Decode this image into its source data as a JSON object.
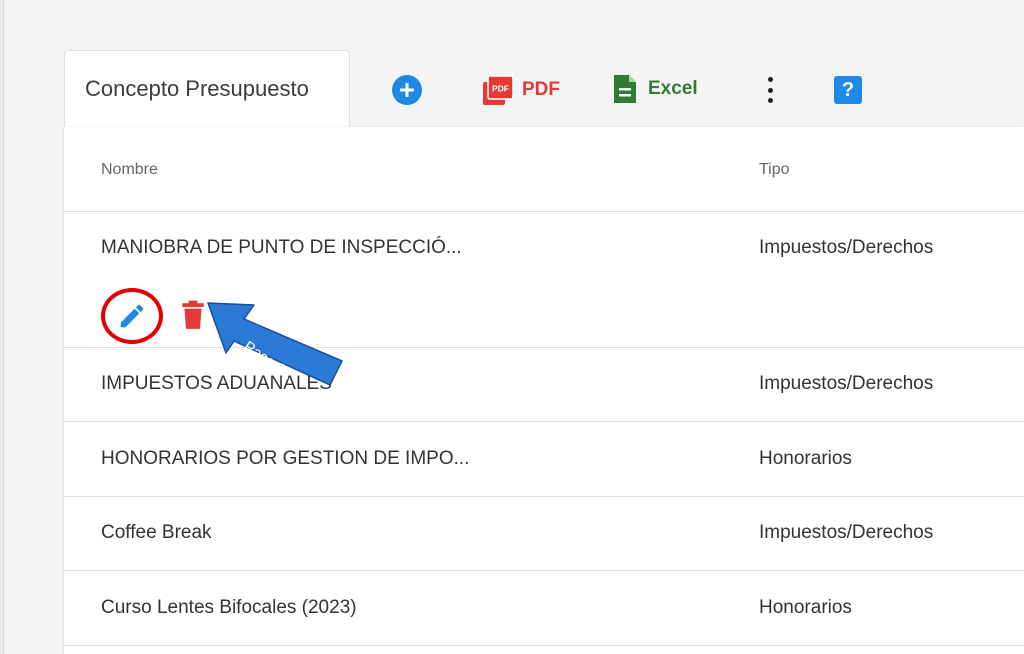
{
  "tab": {
    "label": "Concepto Presupuesto"
  },
  "toolbar": {
    "pdf_label": "PDF",
    "pdf_badge": "PDF",
    "excel_label": "Excel",
    "help_label": "?"
  },
  "table": {
    "headers": [
      "Nombre",
      "Tipo"
    ],
    "rows": [
      {
        "nombre": "MANIOBRA DE PUNTO DE INSPECCIÓ...",
        "tipo": "Impuestos/Derechos"
      },
      {
        "nombre": "IMPUESTOS ADUANALES",
        "tipo": "Impuestos/Derechos"
      },
      {
        "nombre": "HONORARIOS POR GESTION DE IMPO...",
        "tipo": "Honorarios"
      },
      {
        "nombre": "Coffee Break",
        "tipo": "Impuestos/Derechos"
      },
      {
        "nombre": "Curso Lentes Bifocales (2023)",
        "tipo": "Honorarios"
      }
    ]
  },
  "annotation": {
    "text": "Paso 12"
  },
  "colors": {
    "primary": "#1e88e5",
    "pdf": "#e53935",
    "excel": "#2e7d32",
    "highlight": "#e00000",
    "arrow": "#2b79d6"
  },
  "icons": [
    "add-icon",
    "pdf-icon",
    "excel-icon",
    "more-vert-icon",
    "help-icon",
    "edit-icon",
    "delete-icon"
  ]
}
